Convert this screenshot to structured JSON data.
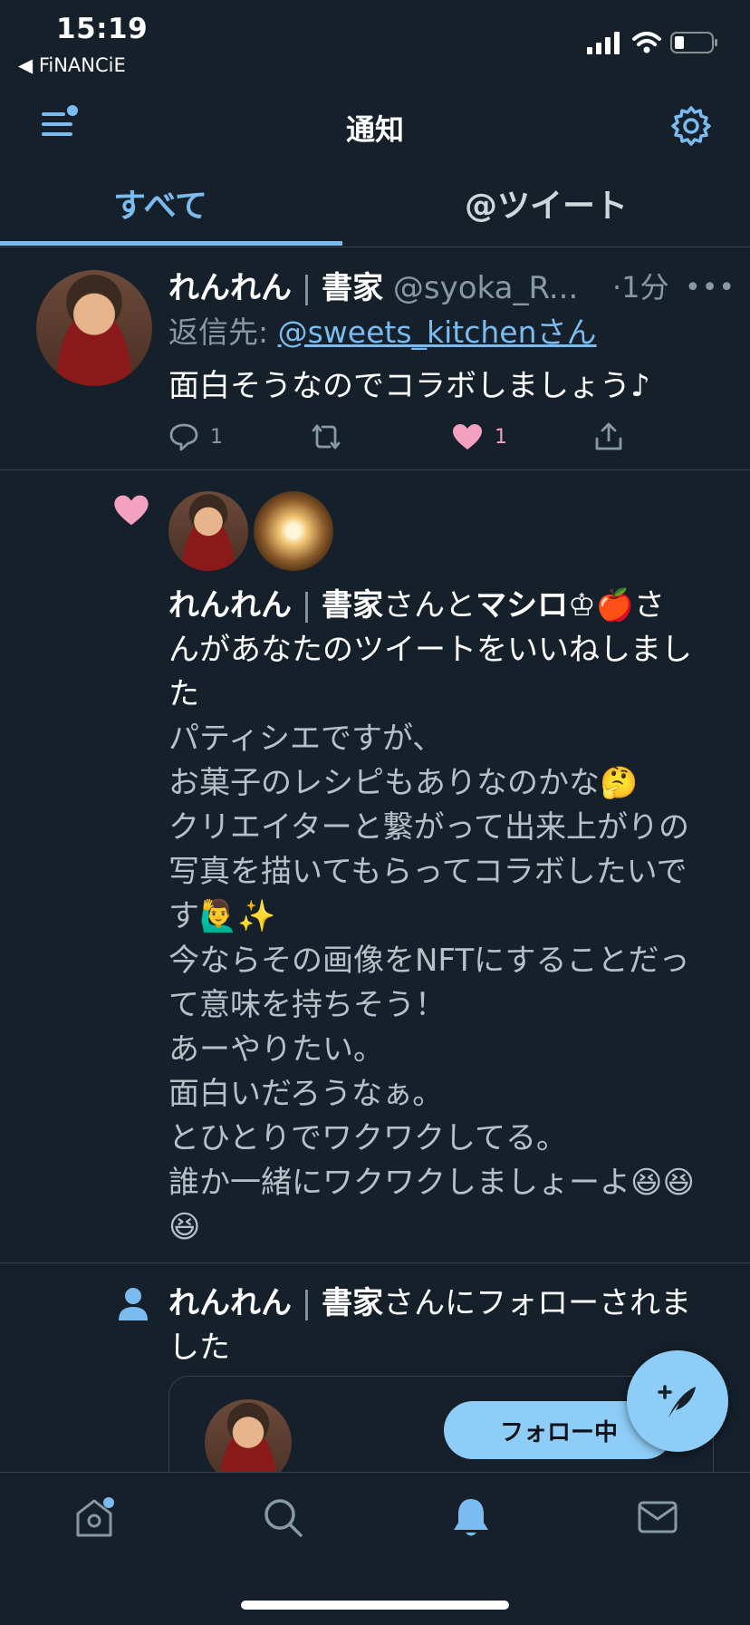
{
  "status_bar": {
    "time": "15:19",
    "back_app": "◀ FiNANCiE"
  },
  "header": {
    "title": "通知"
  },
  "tabs": [
    {
      "label": "すべて",
      "active": true
    },
    {
      "label": "@ツイート",
      "active": false
    }
  ],
  "reply_tweet": {
    "display_name": "れんれん",
    "name_suffix": "書家",
    "handle": "@syoka_R...",
    "time": "·1分",
    "reply_prefix": "返信先: ",
    "reply_to": "@sweets_kitchenさん",
    "text": "面白そうなのでコラボしましょう♪",
    "reply_count": "1",
    "like_count": "1"
  },
  "like_notification": {
    "user1_name": "れんれん",
    "user1_suffix": "書家",
    "joiner": "さんと",
    "user2_name": "マシロ♔🍎",
    "text_after": "さんがあなたのツイートをいいねしました",
    "liked_tweet_text": "パティシエですが、\nお菓子のレシピもありなのかな🤔\nクリエイターと繋がって出来上がりの写真を描いてもらってコラボしたいです🙋‍♂️✨\n今ならその画像をNFTにすることだって意味を持ちそう！\nあーやりたい。\n面白いだろうなぁ。\nとひとりでワクワクしてる。\n誰か一緒にワクワクしましょーよ😆😆😆"
  },
  "follow_notification": {
    "user_name": "れんれん",
    "user_suffix": "書家",
    "text_after": "さんにフォローされました",
    "follow_button_label": "フォロー中"
  },
  "colors": {
    "background": "#15202b",
    "accent": "#7bbcf0",
    "like": "#f4a0c0",
    "muted": "#8899a6"
  },
  "icons": {
    "menu": "menu-icon",
    "settings": "gear-icon",
    "compose": "compose-icon",
    "nav": [
      "home-icon",
      "search-icon",
      "bell-icon",
      "mail-icon"
    ]
  }
}
